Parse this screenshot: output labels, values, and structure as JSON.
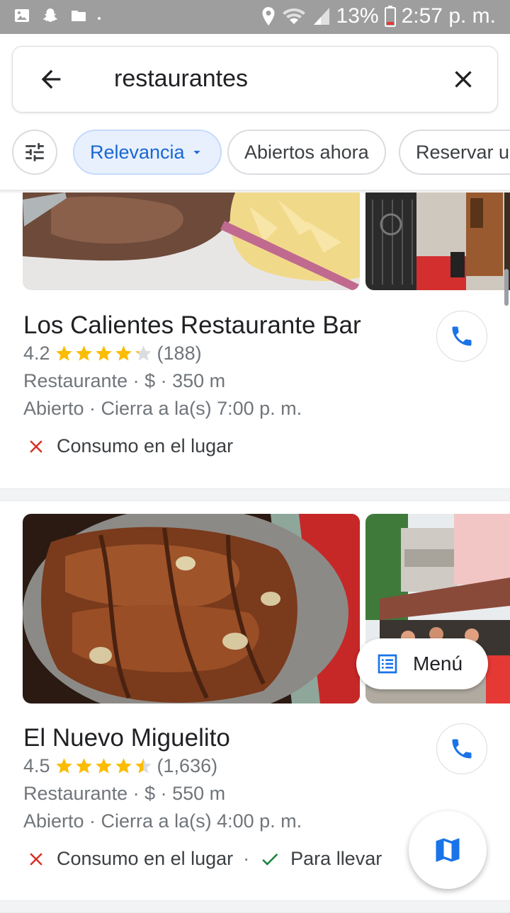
{
  "status_bar": {
    "battery": "13%",
    "time": "2:57 p. m.",
    "icons": [
      "image-icon",
      "snapchat-icon",
      "folder-icon",
      "location-icon",
      "wifi-icon",
      "signal-icon",
      "battery-icon"
    ]
  },
  "search": {
    "query": "restaurantes",
    "icons": [
      "back-arrow-icon",
      "close-icon"
    ]
  },
  "chips": [
    {
      "label": "Relevancia",
      "active": true,
      "icon": "dropdown-icon"
    },
    {
      "label": "Abiertos ahora",
      "active": false
    },
    {
      "label": "Reservar una mesa",
      "active": false
    }
  ],
  "results": [
    {
      "name": "Los Calientes Restaurante Bar",
      "rating": "4.2",
      "rating_value": 4.2,
      "reviews": "(188)",
      "details": "Restaurante · $ · 350 m",
      "hours": "Abierto · Cierra a la(s) 7:00 p. m.",
      "services": [
        {
          "label": "Consumo en el lugar",
          "available": false
        }
      ]
    },
    {
      "name": "El Nuevo Miguelito",
      "rating": "4.5",
      "rating_value": 4.5,
      "reviews": "(1,636)",
      "details": "Restaurante · $ · 550 m",
      "hours": "Abierto · Cierra a la(s) 4:00 p. m.",
      "services": [
        {
          "label": "Consumo en el lugar",
          "available": false
        },
        {
          "label": "Para llevar",
          "available": true
        }
      ],
      "menu_label": "Menú"
    }
  ],
  "colors": {
    "accent": "#1a73e8",
    "star": "#fbbc04",
    "unavailable": "#d93025",
    "available": "#188038"
  }
}
